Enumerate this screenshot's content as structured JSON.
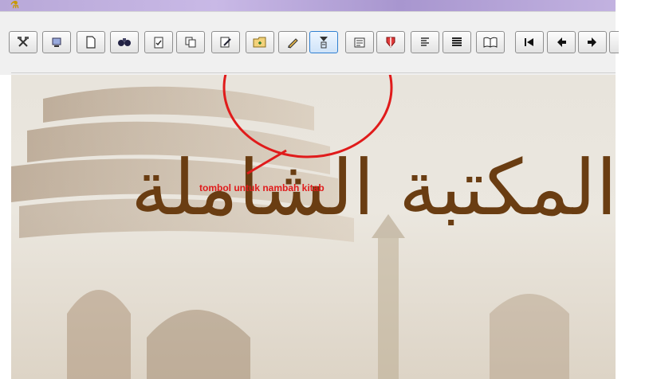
{
  "window": {
    "title_glyph": "⚗"
  },
  "toolbar": {
    "buttons": [
      {
        "name": "tools-button",
        "icon": "hammer-icon",
        "glyph": "⚒"
      },
      {
        "name": "network-button",
        "icon": "network-icon",
        "glyph": "☎"
      },
      {
        "name": "new-button",
        "icon": "new-page-icon",
        "glyph": "▯"
      },
      {
        "name": "search-button",
        "icon": "binoculars-icon",
        "glyph": "⌖"
      },
      {
        "name": "checklist-button",
        "icon": "clipboard-icon",
        "glyph": "☑"
      },
      {
        "name": "copy-button",
        "icon": "copy-icon",
        "glyph": "❐"
      },
      {
        "name": "edit-page-button",
        "icon": "edit-page-icon",
        "glyph": "✍"
      },
      {
        "name": "add-book-button",
        "icon": "folder-add-icon",
        "glyph": "▤"
      },
      {
        "name": "pencil-button",
        "icon": "pencil-icon",
        "glyph": "✎"
      },
      {
        "name": "filter-button",
        "icon": "filter-icon",
        "glyph": "⧗"
      },
      {
        "name": "properties-button",
        "icon": "properties-icon",
        "glyph": "☰"
      },
      {
        "name": "shield-button",
        "icon": "shield-icon",
        "glyph": "⛨"
      },
      {
        "name": "index-button",
        "icon": "list-numbered-icon",
        "glyph": "≡"
      },
      {
        "name": "list-button",
        "icon": "list-icon",
        "glyph": "☰"
      },
      {
        "name": "book-button",
        "icon": "open-book-icon",
        "glyph": "☷"
      },
      {
        "name": "first-button",
        "icon": "first-icon",
        "glyph": "⏮"
      },
      {
        "name": "prev-button",
        "icon": "arrow-left-icon",
        "glyph": "◀"
      },
      {
        "name": "next-button",
        "icon": "arrow-right-icon",
        "glyph": "▶"
      }
    ]
  },
  "annotation": {
    "caption": "tombol untuk nambah kitab",
    "color": "#e01b1b"
  },
  "banner": {
    "calligraphy_lines": [
      "المكتبة الشاملة"
    ],
    "brand_color": "#6a3d12"
  }
}
